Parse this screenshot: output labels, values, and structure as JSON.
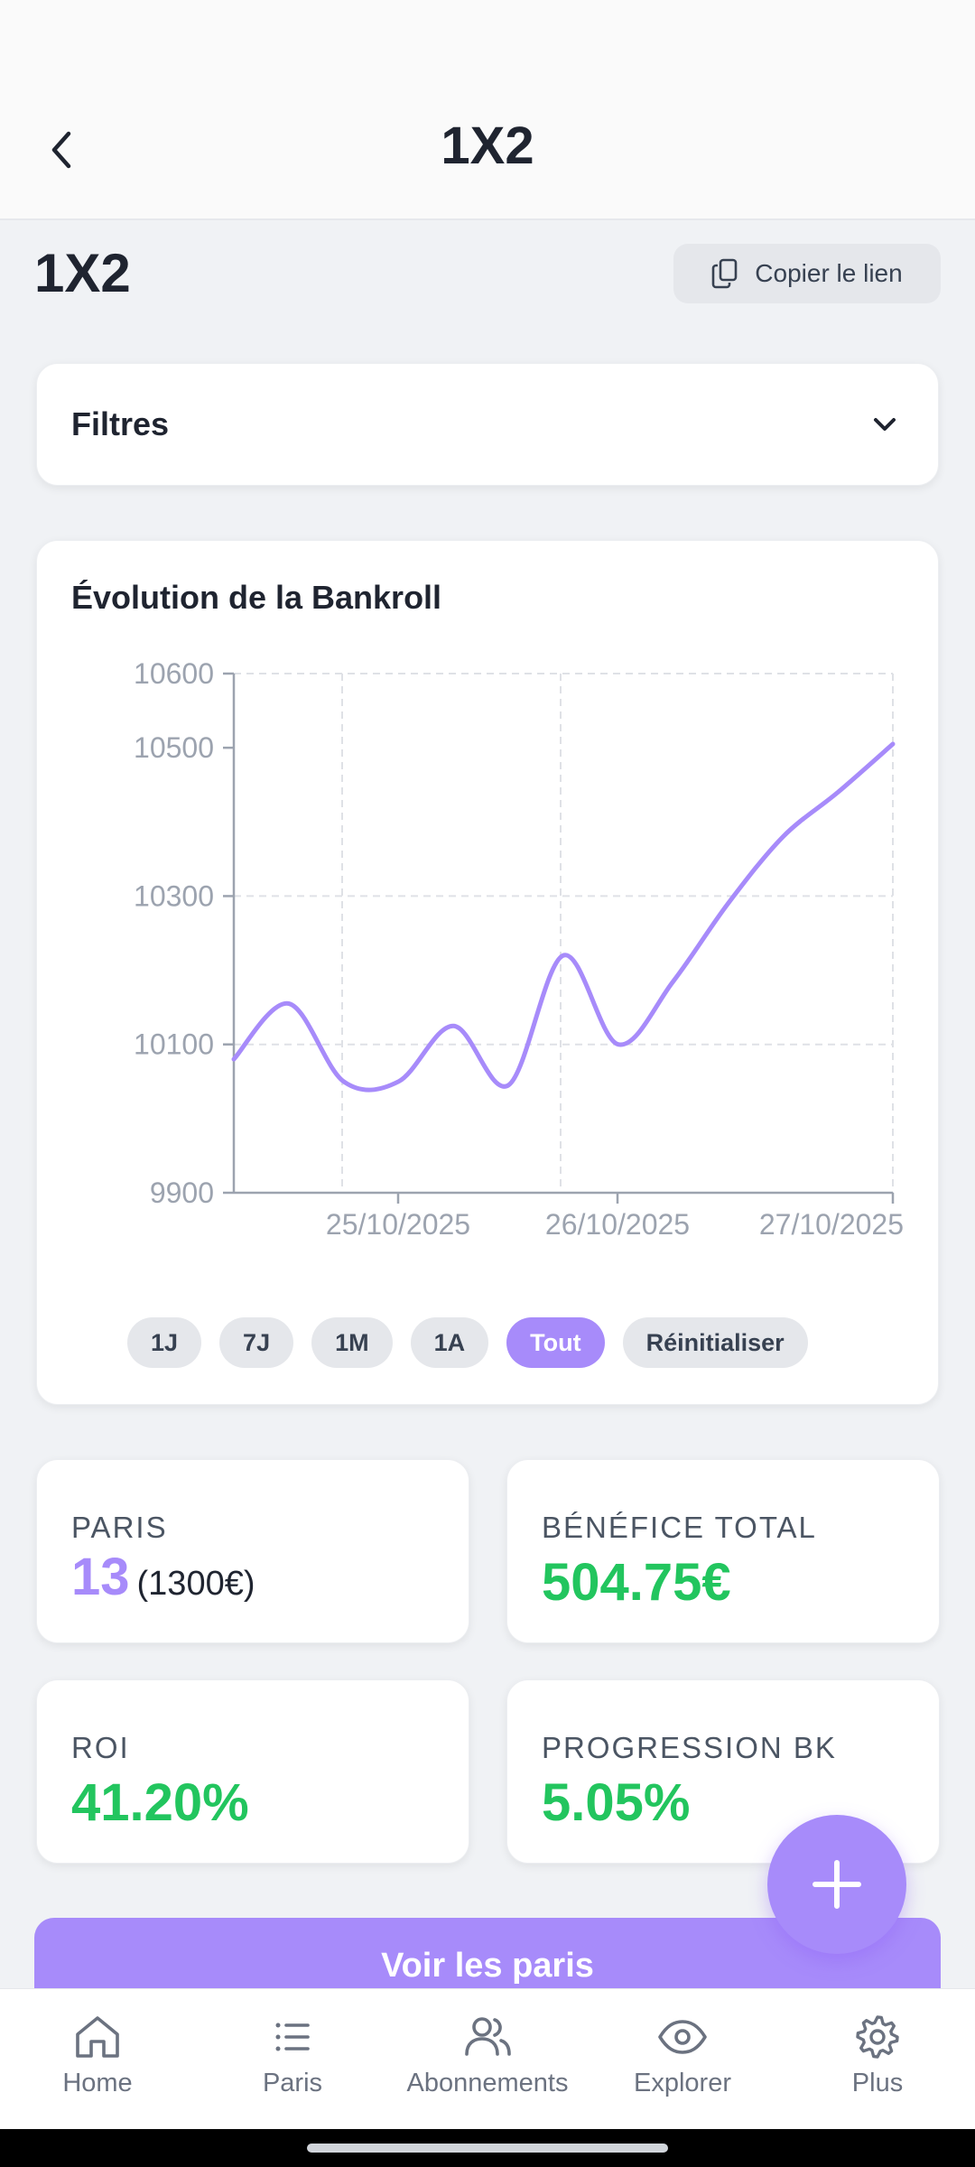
{
  "header": {
    "title": "1X2"
  },
  "page": {
    "title": "1X2",
    "copy_link_label": "Copier le lien"
  },
  "filters": {
    "title": "Filtres"
  },
  "chart_card": {
    "title": "Évolution de la Bankroll"
  },
  "chart_data": {
    "type": "line",
    "title": "Évolution de la Bankroll",
    "xlabel": "",
    "ylabel": "",
    "ylim": [
      9900,
      10600
    ],
    "y_ticks": [
      9900,
      10100,
      10300,
      10500,
      10600
    ],
    "x_tick_labels": [
      "25/10/2025",
      "26/10/2025",
      "27/10/2025"
    ],
    "grid": true,
    "series": [
      {
        "color": "#a78bfa",
        "points": [
          [
            0,
            10080
          ],
          [
            1,
            10155
          ],
          [
            2,
            10050
          ],
          [
            3,
            10050
          ],
          [
            4,
            10125
          ],
          [
            5,
            10045
          ],
          [
            6,
            10220
          ],
          [
            7,
            10100
          ],
          [
            8,
            10185
          ],
          [
            9,
            10290
          ],
          [
            10,
            10380
          ],
          [
            11,
            10440
          ],
          [
            12,
            10505
          ]
        ]
      }
    ]
  },
  "range_buttons": [
    "1J",
    "7J",
    "1M",
    "1A",
    "Tout",
    "Réinitialiser"
  ],
  "range_active": "Tout",
  "stats": {
    "paris": {
      "label": "PARIS",
      "count": "13",
      "amount": "(1300€)"
    },
    "benefice": {
      "label": "BÉNÉFICE TOTAL",
      "value": "504.75€"
    },
    "roi": {
      "label": "ROI",
      "value": "41.20%"
    },
    "progression": {
      "label": "PROGRESSION BK",
      "value": "5.05%"
    }
  },
  "voir_paris_label": "Voir les paris",
  "nav": [
    {
      "label": "Home",
      "icon": "home-icon"
    },
    {
      "label": "Paris",
      "icon": "list-icon"
    },
    {
      "label": "Abonnements",
      "icon": "users-icon"
    },
    {
      "label": "Explorer",
      "icon": "eye-icon"
    },
    {
      "label": "Plus",
      "icon": "gear-icon"
    }
  ],
  "colors": {
    "accent": "#a78bfa",
    "positive": "#22c55e"
  }
}
